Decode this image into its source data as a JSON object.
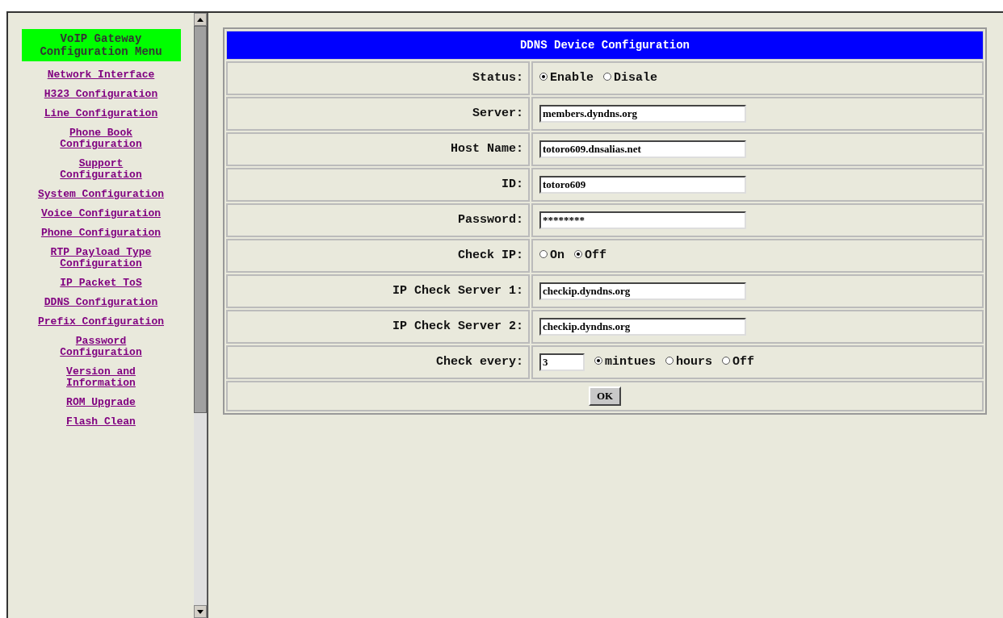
{
  "menu": {
    "title": "VoIP Gateway Configuration Menu",
    "items": [
      {
        "label": "Network Interface"
      },
      {
        "label": "H323 Configuration"
      },
      {
        "label": "Line Configuration"
      },
      {
        "label": "Phone Book Configuration"
      },
      {
        "label": "Support Configuration"
      },
      {
        "label": "System Configuration"
      },
      {
        "label": "Voice Configuration"
      },
      {
        "label": "Phone Configuration"
      },
      {
        "label": "RTP Payload Type Configuration"
      },
      {
        "label": "IP Packet ToS"
      },
      {
        "label": "DDNS Configuration"
      },
      {
        "label": "Prefix Configuration"
      },
      {
        "label": "Password Configuration"
      },
      {
        "label": "Version and Information"
      },
      {
        "label": "ROM Upgrade"
      },
      {
        "label": "Flash Clean"
      }
    ]
  },
  "form": {
    "title": "DDNS Device Configuration",
    "rows": [
      {
        "kind": "radio",
        "label": "Status:",
        "options": [
          {
            "label": "Enable",
            "selected": true
          },
          {
            "label": "Disale",
            "selected": false
          }
        ]
      },
      {
        "kind": "text",
        "label": "Server:",
        "value": "members.dyndns.org"
      },
      {
        "kind": "text",
        "label": "Host Name:",
        "value": "totoro609.dnsalias.net"
      },
      {
        "kind": "text",
        "label": "ID:",
        "value": "totoro609"
      },
      {
        "kind": "text",
        "label": "Password:",
        "value": "********"
      },
      {
        "kind": "radio",
        "label": "Check IP:",
        "options": [
          {
            "label": "On",
            "selected": false
          },
          {
            "label": "Off",
            "selected": true
          }
        ]
      },
      {
        "kind": "text",
        "label": "IP Check Server 1:",
        "value": "checkip.dyndns.org"
      },
      {
        "kind": "text",
        "label": "IP Check Server 2:",
        "value": "checkip.dyndns.org"
      },
      {
        "kind": "interval",
        "label": "Check every:",
        "value": "3",
        "options": [
          {
            "label": "mintues",
            "selected": true
          },
          {
            "label": "hours",
            "selected": false
          },
          {
            "label": "Off",
            "selected": false
          }
        ]
      }
    ],
    "submit": "OK"
  }
}
